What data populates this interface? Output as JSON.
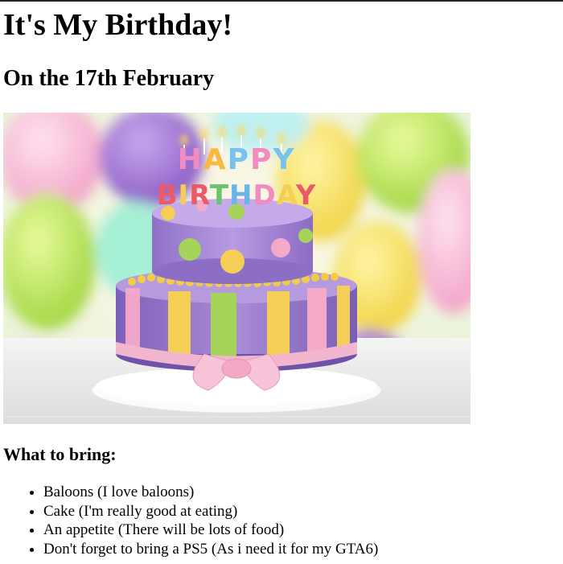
{
  "page": {
    "title": "It's My Birthday!",
    "date_heading": "On the 17th February",
    "image": {
      "icon": "birthday-cake-photo",
      "topper_line_1": "HAPPY",
      "topper_line_2": "BIRTHDAY"
    },
    "bring_heading": "What to bring:",
    "bring_items": [
      {
        "label": "Baloons (I love baloons)"
      },
      {
        "label": "Cake (I'm really good at eating)"
      },
      {
        "label": "An appetite (There will be lots of food)"
      },
      {
        "label": "Don't forget to bring a PS5 (As i need it for my GTA6)"
      }
    ]
  },
  "colors": {
    "background": "#ffffff",
    "text": "#000000",
    "cake_top": "#a98bd6",
    "cake_bottom": "#9a7cd0",
    "ribbon": "#f3b6cf"
  }
}
